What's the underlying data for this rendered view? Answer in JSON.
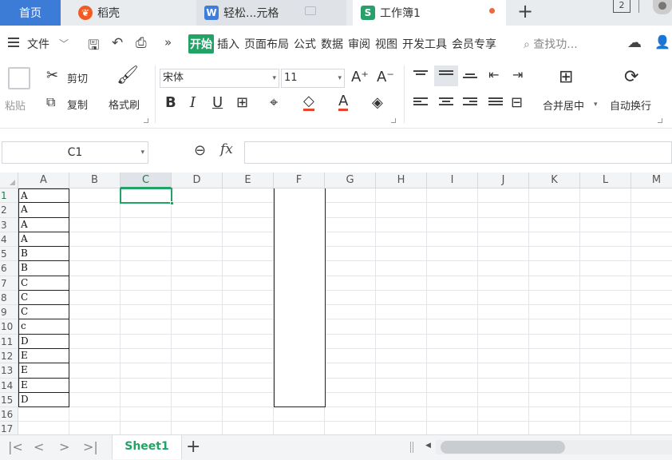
{
  "tabs": {
    "home": "首页",
    "daoke": "稻壳",
    "doc": "轻松...元格",
    "workbook": "工作簿1",
    "new_tab": "+",
    "window_count": "2"
  },
  "menu": {
    "file": "文件",
    "items": [
      "开始",
      "插入",
      "页面布局",
      "公式",
      "数据",
      "审阅",
      "视图",
      "开发工具",
      "会员专享"
    ],
    "active": "开始",
    "search_placeholder": "查找功..."
  },
  "ribbon": {
    "paste": "粘贴",
    "cut": "剪切",
    "copy": "复制",
    "format_painter": "格式刷",
    "font_name": "宋体",
    "font_size": "11",
    "merge_center": "合并居中",
    "wrap_text": "自动换行"
  },
  "formula_bar": {
    "name_box": "C1",
    "fx": "fx",
    "formula": ""
  },
  "sheet": {
    "columns": [
      "A",
      "B",
      "C",
      "D",
      "E",
      "F",
      "G",
      "H",
      "I",
      "J",
      "K",
      "L",
      "M"
    ],
    "rows": [
      "1",
      "2",
      "3",
      "4",
      "5",
      "6",
      "7",
      "8",
      "9",
      "10",
      "11",
      "12",
      "13",
      "14",
      "15",
      "16",
      "17"
    ],
    "selected_cell": "C1",
    "column_a_values": [
      "A",
      "A",
      "A",
      "A",
      "B",
      "B",
      "C",
      "C",
      "C",
      "c",
      "D",
      "E",
      "E",
      "E",
      "D"
    ]
  },
  "sheet_tabs": {
    "active": "Sheet1",
    "add": "+"
  },
  "colors": {
    "accent": "#21a366",
    "home_tab": "#3c7bd6"
  }
}
